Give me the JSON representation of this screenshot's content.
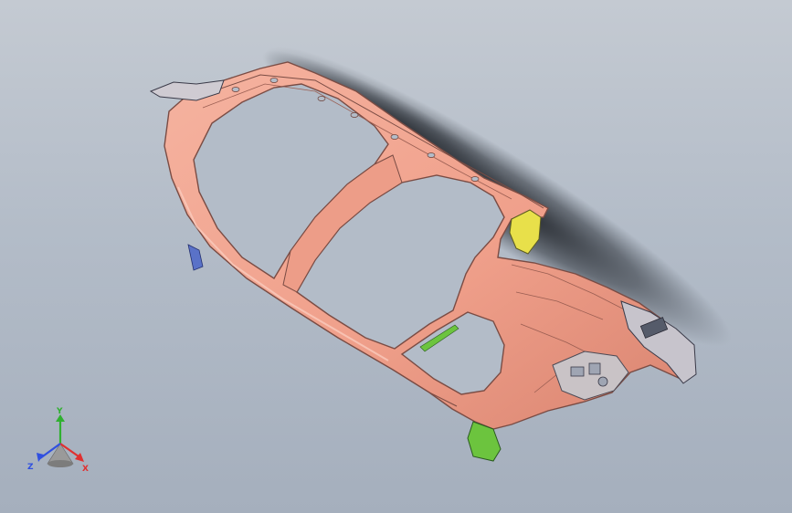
{
  "viewport": {
    "background_top": "#c4cad2",
    "background_bottom": "#a5afbd",
    "model": {
      "body_color": "#f2a48f",
      "edge_color": "#7a4c44",
      "bracket_yellow": "#e8e04a",
      "bracket_green": "#6cc43e",
      "bracket_blue": "#5a72c8",
      "shadow_color": "#1a1d22"
    }
  },
  "triad": {
    "x_label": "X",
    "y_label": "Y",
    "z_label": "Z",
    "x_color": "#e03030",
    "y_color": "#30b030",
    "z_color": "#3050e0"
  }
}
